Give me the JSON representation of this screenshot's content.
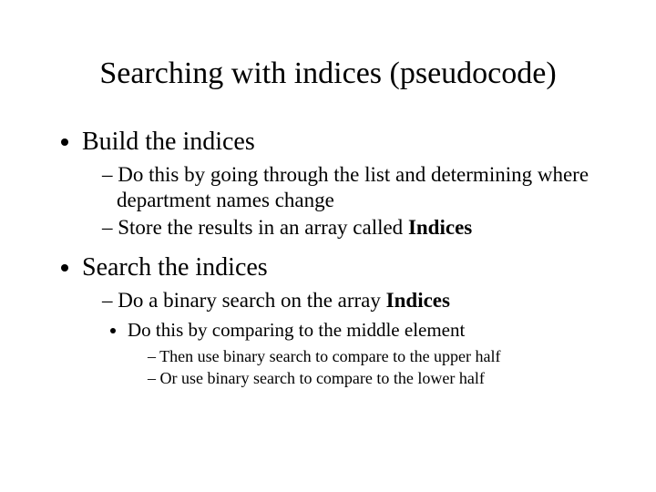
{
  "title": "Searching with indices (pseudocode)",
  "bullets": {
    "b1": {
      "label": "Build the indices",
      "sub": {
        "s1": "– Do this by going through the list and determining where department names change",
        "s2_pre": "– Store the results in an array called ",
        "s2_bold": "Indices"
      }
    },
    "b2": {
      "label": "Search the indices",
      "sub": {
        "s1_pre": "– Do a binary search on the array ",
        "s1_bold": "Indices",
        "s2": {
          "label": "Do this by comparing to the middle element",
          "sub": {
            "d1": "– Then use binary search to compare to the upper half",
            "d2": "– Or use binary search to compare to the lower half"
          }
        }
      }
    }
  }
}
